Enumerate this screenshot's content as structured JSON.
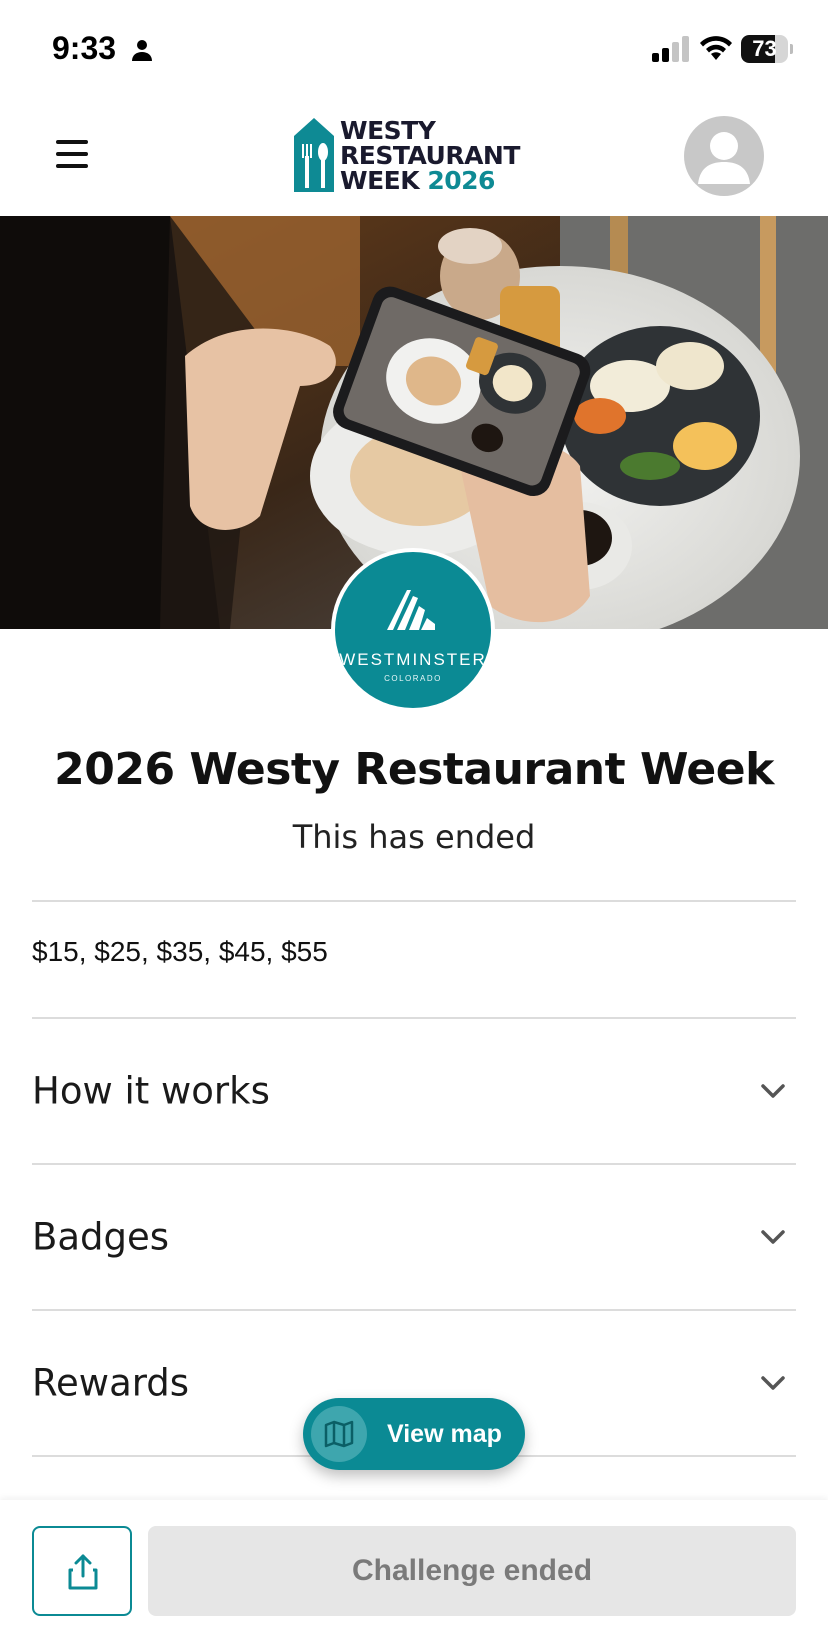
{
  "status_bar": {
    "time": "9:33",
    "battery": "73",
    "battery_level": 0.73
  },
  "header": {
    "logo_lines": [
      "WESTY",
      "RESTAURANT"
    ],
    "logo_line3_prefix": "WEEK",
    "logo_year": "2026",
    "icons": [
      "menu-icon",
      "avatar-icon"
    ]
  },
  "hero": {
    "brand_name": "WESTMINSTER",
    "brand_sub": "COLORADO"
  },
  "event": {
    "title": "2026 Westy Restaurant Week",
    "status": "This has ended",
    "prices": "$15, $25, $35, $45, $55"
  },
  "accordions": [
    {
      "label": "How it works"
    },
    {
      "label": "Badges"
    },
    {
      "label": "Rewards"
    }
  ],
  "floating": {
    "view_map_label": "View map"
  },
  "bottom_bar": {
    "challenge_label": "Challenge ended"
  },
  "colors": {
    "accent": "#0b8a94",
    "disabled_bg": "#e6e6e6",
    "disabled_text": "#7a7a7a"
  }
}
